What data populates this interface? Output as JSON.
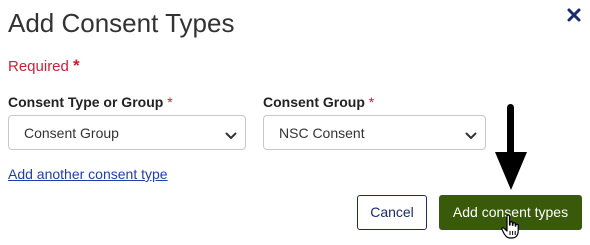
{
  "dialog": {
    "title": "Add Consent Types",
    "required_note": "Required",
    "required_star": "*",
    "close_icon": "close-icon"
  },
  "fields": {
    "consent_type": {
      "label": "Consent Type or Group",
      "required_marker": "*",
      "selected_value": "Consent Group"
    },
    "consent_group": {
      "label": "Consent Group",
      "required_marker": "*",
      "selected_value": "NSC Consent"
    }
  },
  "links": {
    "add_another": "Add another consent type"
  },
  "buttons": {
    "cancel": "Cancel",
    "submit": "Add consent types"
  },
  "annotations": {
    "arrow_icon": "down-arrow-icon",
    "cursor_icon": "hand-pointer-icon"
  },
  "colors": {
    "required_red": "#d11a2a",
    "primary_green": "#3a5a0b",
    "link_blue": "#1f3fa8",
    "cancel_navy": "#1a2a6c"
  }
}
